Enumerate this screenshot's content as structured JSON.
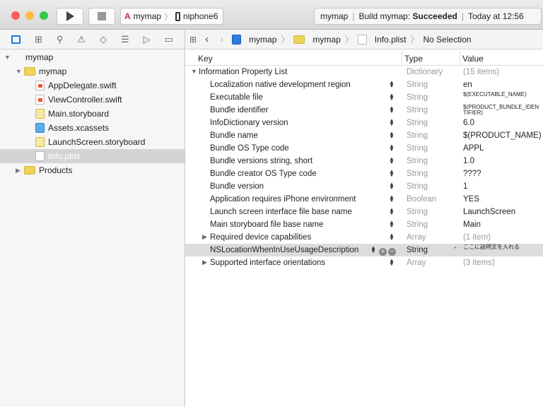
{
  "toolbar": {
    "scheme": "mymap",
    "device": "niphone6",
    "activity_project": "mymap",
    "activity_build": "Build mymap: ",
    "activity_status": "Succeeded",
    "activity_time": "Today at 12:56"
  },
  "jumpbar": {
    "items": [
      "mymap",
      "mymap",
      "Info.plist",
      "No Selection"
    ]
  },
  "navigator_icons": [
    "folder-icon",
    "hierarchy-icon",
    "search-icon",
    "warning-icon",
    "test-icon",
    "debug-icon",
    "breakpoint-icon",
    "report-icon"
  ],
  "sidebar": {
    "items": [
      {
        "label": "mymap",
        "kind": "project",
        "indent": 0,
        "tri": "▼"
      },
      {
        "label": "mymap",
        "kind": "folder",
        "indent": 1,
        "tri": "▼"
      },
      {
        "label": "AppDelegate.swift",
        "kind": "swift",
        "indent": 2
      },
      {
        "label": "ViewController.swift",
        "kind": "swift",
        "indent": 2
      },
      {
        "label": "Main.storyboard",
        "kind": "sb",
        "indent": 2
      },
      {
        "label": "Assets.xcassets",
        "kind": "assets",
        "indent": 2
      },
      {
        "label": "LaunchScreen.storyboard",
        "kind": "sb",
        "indent": 2
      },
      {
        "label": "Info.plist",
        "kind": "plist",
        "indent": 2,
        "selected": true
      },
      {
        "label": "Products",
        "kind": "folder",
        "indent": 1,
        "tri": "▶"
      }
    ]
  },
  "plist": {
    "headers": {
      "key": "Key",
      "type": "Type",
      "value": "Value"
    },
    "rows": [
      {
        "key": "Information Property List",
        "type": "Dictionary",
        "value": "(15 items)",
        "tri": "▼",
        "root": true
      },
      {
        "key": "Localization native development region",
        "type": "String",
        "value": "en"
      },
      {
        "key": "Executable file",
        "type": "String",
        "value": "$(EXECUTABLE_NAME)"
      },
      {
        "key": "Bundle identifier",
        "type": "String",
        "value": "$(PRODUCT_BUNDLE_IDENTIFIER)"
      },
      {
        "key": "InfoDictionary version",
        "type": "String",
        "value": "6.0"
      },
      {
        "key": "Bundle name",
        "type": "String",
        "value": "$(PRODUCT_NAME)"
      },
      {
        "key": "Bundle OS Type code",
        "type": "String",
        "value": "APPL"
      },
      {
        "key": "Bundle versions string, short",
        "type": "String",
        "value": "1.0"
      },
      {
        "key": "Bundle creator OS Type code",
        "type": "String",
        "value": "????"
      },
      {
        "key": "Bundle version",
        "type": "String",
        "value": "1"
      },
      {
        "key": "Application requires iPhone environment",
        "type": "Boolean",
        "value": "YES"
      },
      {
        "key": "Launch screen interface file base name",
        "type": "String",
        "value": "LaunchScreen"
      },
      {
        "key": "Main storyboard file base name",
        "type": "String",
        "value": "Main"
      },
      {
        "key": "Required device capabilities",
        "type": "Array",
        "value": "(1 item)",
        "tri": "▶"
      },
      {
        "key": "NSLocationWhenInUseUsageDescription",
        "type": "String",
        "value": "ここに説明文を入れる",
        "selected": true
      },
      {
        "key": "Supported interface orientations",
        "type": "Array",
        "value": "(3 items)",
        "tri": "▶"
      }
    ]
  }
}
